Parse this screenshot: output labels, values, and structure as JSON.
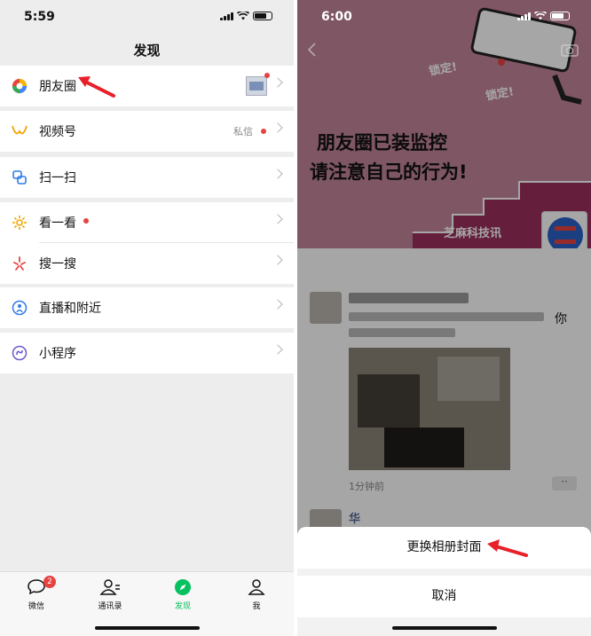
{
  "left": {
    "status_time": "5:59",
    "title": "发现",
    "menu": [
      {
        "label": "朋友圈"
      },
      {
        "label": "视频号",
        "extra": "私信"
      },
      {
        "label": "扫一扫"
      },
      {
        "label": "看一看"
      },
      {
        "label": "搜一搜"
      },
      {
        "label": "直播和附近"
      },
      {
        "label": "小程序"
      }
    ],
    "tabs": [
      {
        "label": "微信",
        "badge": "2"
      },
      {
        "label": "通讯录"
      },
      {
        "label": "发现"
      },
      {
        "label": "我"
      }
    ]
  },
  "right": {
    "status_time": "6:00",
    "cover": {
      "lock1": "锁定!",
      "lock2": "锁定!",
      "line1": "朋友圈已装监控",
      "line2": "请注意自己的行为!",
      "brand": "芝麻科技讯"
    },
    "post": {
      "text_tail": "你",
      "time": "1分钟前",
      "next_name": "华"
    },
    "sheet": {
      "change_cover": "更换相册封面",
      "cancel": "取消"
    }
  },
  "colors": {
    "accent_red": "#e64340",
    "wechat_green": "#07c160",
    "cover_pink": "#c4859a",
    "arrow_red": "#e8202a"
  }
}
